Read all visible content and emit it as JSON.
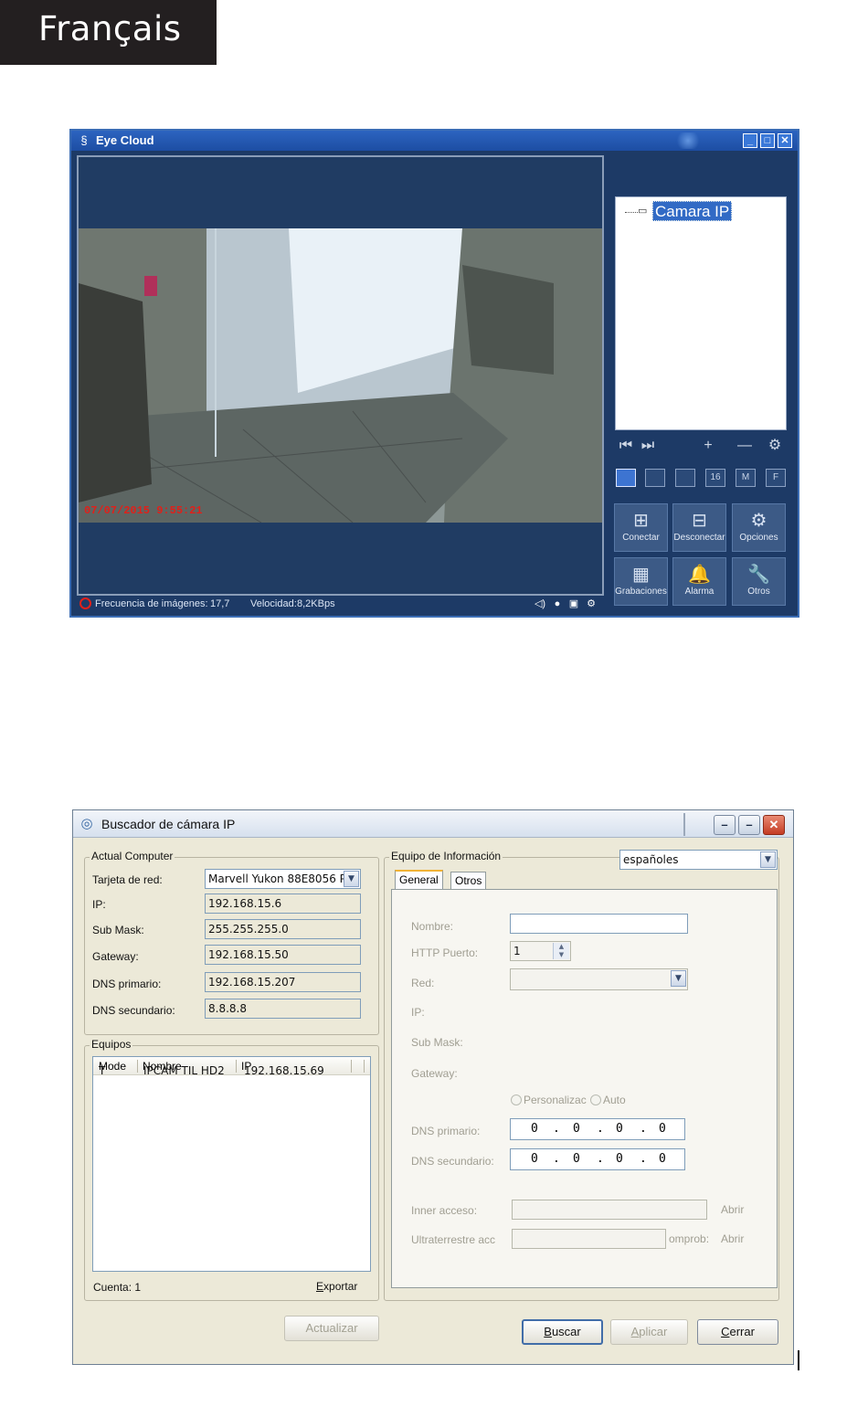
{
  "header": {
    "language": "Français"
  },
  "eye_cloud": {
    "title": "Eye Cloud",
    "window_buttons": {
      "minimize": "_",
      "maximize": "□",
      "close": "✕"
    },
    "video": {
      "timestamp": "07/07/2015 9:55:21"
    },
    "status": {
      "frame_rate_label": "Frecuencia de imágenes:",
      "frame_rate_value": "17,7",
      "speed_label": "Velocidad:",
      "speed_value": "8,2KBps"
    },
    "tree": {
      "root_label": "Camara IP"
    },
    "controls": {
      "prev": "⏮",
      "next": "⏭",
      "add": "+",
      "remove": "—",
      "settings": "⚙"
    },
    "layouts": [
      "",
      "",
      "",
      "16",
      "M",
      "F"
    ],
    "actions": [
      {
        "label": "Conectar",
        "glyph": "⊞"
      },
      {
        "label": "Desconectar",
        "glyph": "⊟"
      },
      {
        "label": "Opciones",
        "glyph": "⚙"
      },
      {
        "label": "Grabaciones",
        "glyph": "▦"
      },
      {
        "label": "Alarma",
        "glyph": "🔔"
      },
      {
        "label": "Otros",
        "glyph": "🔧"
      }
    ]
  },
  "buscador": {
    "title": "Buscador de cámara IP",
    "actual_computer": {
      "group_title": "Actual Computer",
      "network_card_label": "Tarjeta de red:",
      "network_card_value": "Marvell Yukon 88E8056 P",
      "ip_label": "IP:",
      "ip_value": "192.168.15.6",
      "submask_label": "Sub Mask:",
      "submask_value": "255.255.255.0",
      "gateway_label": "Gateway:",
      "gateway_value": "192.168.15.50",
      "dns1_label": "DNS primario:",
      "dns1_value": "192.168.15.207",
      "dns2_label": "DNS secundario:",
      "dns2_value": "8.8.8.8"
    },
    "equipos": {
      "group_title": "Equipos",
      "columns": [
        "Mode",
        "Nombre",
        "IP"
      ],
      "rows": [
        {
          "mode": "T",
          "name": "IPCAM TIL HD2",
          "ip": "192.168.15.69"
        }
      ],
      "count_label": "Cuenta: 1",
      "export_label": "Exportar"
    },
    "info": {
      "group_title": "Equipo de Información",
      "language_value": "españoles",
      "tabs": [
        "General",
        "Otros"
      ],
      "name_label": "Nombre:",
      "http_port_label": "HTTP Puerto:",
      "http_port_value": "1",
      "network_label": "Red:",
      "ip_label": "IP:",
      "submask_label": "Sub Mask:",
      "gateway_label": "Gateway:",
      "radio_custom": "Personalizac",
      "radio_auto": "Auto",
      "dns1_label": "DNS primario:",
      "dns2_label": "DNS secundario:",
      "dns1_octets": [
        "0",
        "0",
        "0",
        "0"
      ],
      "dns2_octets": [
        "0",
        "0",
        "0",
        "0"
      ],
      "inner_access_label": "Inner acceso:",
      "ultra_label": "Ultraterrestre acc",
      "check_label": "omprob:",
      "open_label": "Abrir"
    },
    "buttons": {
      "refresh": "Actualizar",
      "search": "Buscar",
      "apply": "Aplicar",
      "close": "Cerrar"
    }
  }
}
